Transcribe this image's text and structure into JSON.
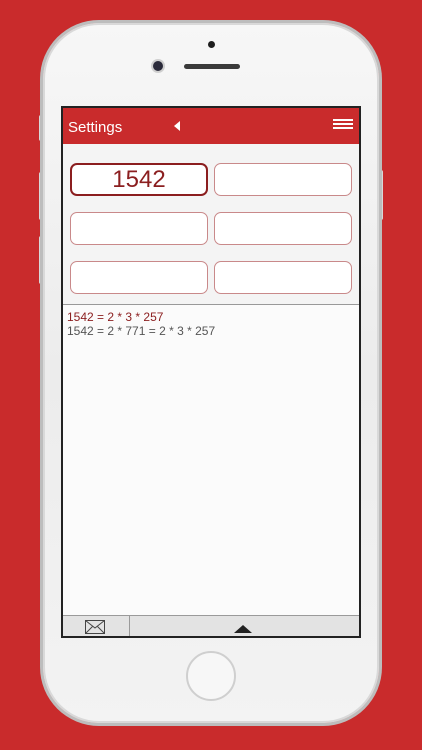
{
  "header": {
    "title": "Settings",
    "back_icon": "back-arrow-icon",
    "menu_icon": "menu-icon"
  },
  "inputs": [
    {
      "value": "1542",
      "active": true
    },
    {
      "value": "",
      "active": false
    },
    {
      "value": "",
      "active": false
    },
    {
      "value": "",
      "active": false
    },
    {
      "value": "",
      "active": false
    },
    {
      "value": "",
      "active": false
    }
  ],
  "results": {
    "primary": "1542 = 2 * 3 * 257",
    "secondary": "1542 = 2 * 771 = 2 * 3 * 257"
  },
  "toolbar": {
    "mail_icon": "mail-icon",
    "expand_icon": "triangle-up-icon"
  },
  "colors": {
    "accent": "#c92b2c",
    "result_text": "#8b1e1f",
    "secondary_text": "#555555"
  }
}
